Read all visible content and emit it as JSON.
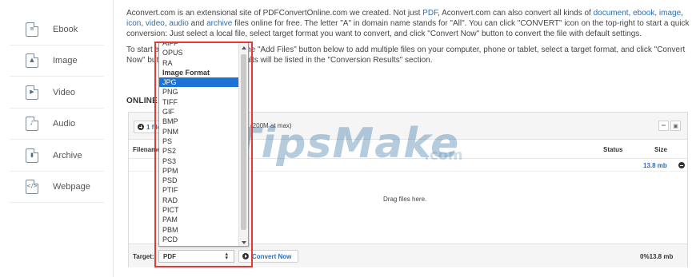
{
  "sidebar": {
    "items": [
      {
        "label": "Ebook",
        "glyph": "≡"
      },
      {
        "label": "Image",
        "glyph": "▲"
      },
      {
        "label": "Video",
        "glyph": "▶"
      },
      {
        "label": "Audio",
        "glyph": "♪"
      },
      {
        "label": "Archive",
        "glyph": "▮"
      },
      {
        "label": "Webpage",
        "glyph": "</>"
      }
    ]
  },
  "intro": {
    "p1_a": "Aconvert.com is an extensional site of PDFConvertOnline.com we created. Not just ",
    "p1_link_pdf": "PDF",
    "p1_b": ", Aconvert.com can also convert all kinds of ",
    "p1_link_document": "document",
    "p1_c": ", ",
    "p1_link_ebook": "ebook",
    "p1_d": ", ",
    "p1_link_image": "image",
    "p1_e": ", ",
    "p1_link_icon": "icon",
    "p1_f": ", ",
    "p1_link_video": "video",
    "p1_g": ", ",
    "p1_link_audio": "audio",
    "p1_h": " and ",
    "p1_link_archive": "archive",
    "p1_i": " files online for free. The letter \"A\" in domain name stands for \"All\". You can click \"CONVERT\" icon on the top-right to start a quick conversion: Just select a local file, select target format you want to convert, and click \"Convert Now\" button to convert the file with default settings.",
    "p2": "To start a batch conversion, click the \"Add Files\" button below to add multiple files on your computer, phone or tablet, select a target format, and click \"Convert Now\" button to convert them. Results will be listed in the \"Conversion Results\" section."
  },
  "online_heading": "ONLINE CONVERTER",
  "converter": {
    "add_files_label": "1 file",
    "limit_text": "(200M at max)",
    "col_filename": "Filename",
    "col_status": "Status",
    "col_size": "Size",
    "total_size": "13.8 mb",
    "drop_text": "Drag files here.",
    "target_label": "Target:",
    "target_value": "PDF",
    "convert_label": "Convert Now",
    "progress_text": "0%13.8 mb"
  },
  "watermark": {
    "main": "TipsMake",
    "suffix": ".com"
  },
  "dropdown": {
    "items": [
      {
        "label": "AIFF",
        "type": "option"
      },
      {
        "label": "OPUS",
        "type": "option"
      },
      {
        "label": "RA",
        "type": "option"
      },
      {
        "label": "Image Format",
        "type": "group"
      },
      {
        "label": "JPG",
        "type": "selected"
      },
      {
        "label": "PNG",
        "type": "option"
      },
      {
        "label": "TIFF",
        "type": "option"
      },
      {
        "label": "GIF",
        "type": "option"
      },
      {
        "label": "BMP",
        "type": "option"
      },
      {
        "label": "PNM",
        "type": "option"
      },
      {
        "label": "PS",
        "type": "option"
      },
      {
        "label": "PS2",
        "type": "option"
      },
      {
        "label": "PS3",
        "type": "option"
      },
      {
        "label": "PPM",
        "type": "option"
      },
      {
        "label": "PSD",
        "type": "option"
      },
      {
        "label": "PTIF",
        "type": "option"
      },
      {
        "label": "RAD",
        "type": "option"
      },
      {
        "label": "PICT",
        "type": "option"
      },
      {
        "label": "PAM",
        "type": "option"
      },
      {
        "label": "PBM",
        "type": "option"
      },
      {
        "label": "PCD",
        "type": "option"
      }
    ]
  },
  "colors": {
    "link": "#2a6fb5",
    "highlight": "#e53935",
    "selected": "#1e73d6"
  }
}
